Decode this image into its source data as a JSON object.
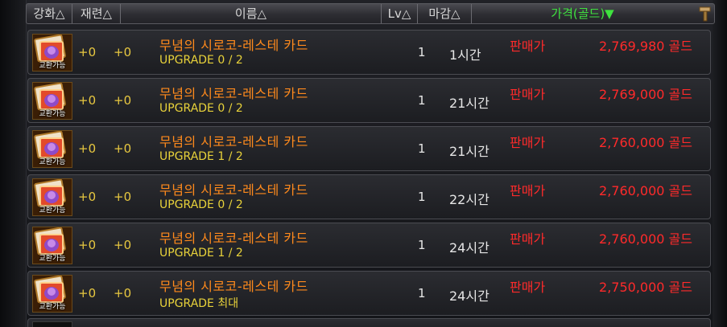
{
  "header": {
    "reinforce": "강화",
    "refine": "재련",
    "name": "이름",
    "lv": "Lv",
    "deadline": "마감",
    "price": "가격(골드)▼",
    "sort_glyph": "△"
  },
  "colors": {
    "item_name": "#ff8a1c",
    "upgrade": "#e8d23a",
    "price": "#ff2a2a",
    "sorted_header": "#3fe23f"
  },
  "rows": [
    {
      "thumb_label": "교환가능",
      "reinforce": "+0",
      "refine": "+0",
      "name": "무념의 시로코-레스테 카드",
      "upgrade": "UPGRADE 0 / 2",
      "lv": "1",
      "time": "1시간",
      "sale": "판매가",
      "price": "2,769,980 골드"
    },
    {
      "thumb_label": "교환가능",
      "reinforce": "+0",
      "refine": "+0",
      "name": "무념의 시로코-레스테 카드",
      "upgrade": "UPGRADE 0 / 2",
      "lv": "1",
      "time": "21시간",
      "sale": "판매가",
      "price": "2,769,000 골드"
    },
    {
      "thumb_label": "교환가능",
      "reinforce": "+0",
      "refine": "+0",
      "name": "무념의 시로코-레스테 카드",
      "upgrade": "UPGRADE 1 / 2",
      "lv": "1",
      "time": "21시간",
      "sale": "판매가",
      "price": "2,760,000 골드"
    },
    {
      "thumb_label": "교환가능",
      "reinforce": "+0",
      "refine": "+0",
      "name": "무념의 시로코-레스테 카드",
      "upgrade": "UPGRADE 0 / 2",
      "lv": "1",
      "time": "22시간",
      "sale": "판매가",
      "price": "2,760,000 골드"
    },
    {
      "thumb_label": "교환가능",
      "reinforce": "+0",
      "refine": "+0",
      "name": "무념의 시로코-레스테 카드",
      "upgrade": "UPGRADE 1 / 2",
      "lv": "1",
      "time": "24시간",
      "sale": "판매가",
      "price": "2,760,000 골드"
    },
    {
      "thumb_label": "교환가능",
      "reinforce": "+0",
      "refine": "+0",
      "name": "무념의 시로코-레스테 카드",
      "upgrade": "UPGRADE 최대",
      "lv": "1",
      "time": "24시간",
      "sale": "판매가",
      "price": "2,750,000 골드"
    }
  ]
}
